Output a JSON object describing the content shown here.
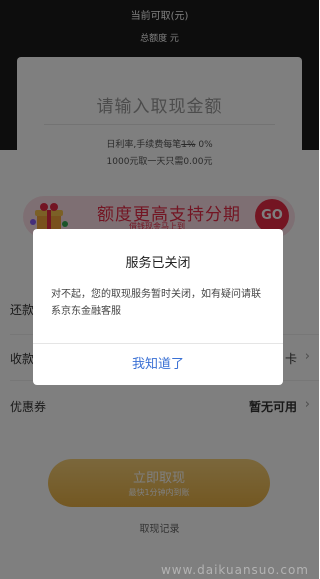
{
  "header": {
    "available_label": "当前可取(元)",
    "total_label": "总额度 元"
  },
  "amount_card": {
    "amount_placeholder": "请输入取现金额",
    "rate_prefix": "日利率,手续费每笔",
    "rate_old": "1%",
    "rate_new": " 0%",
    "interest_note": "1000元取一天只需0.00元"
  },
  "promo": {
    "title": "额度更高支持分期",
    "subtitle": "借钱现金马上到",
    "go_label": "GO"
  },
  "rows": {
    "repay_label": "还款",
    "receive_label": "收款",
    "receive_value": "卡",
    "coupon_label": "优惠券",
    "coupon_value": "暂无可用"
  },
  "withdraw_button": {
    "label": "立即取现",
    "sub": "最快1分钟内到账"
  },
  "records_link": "取现记录",
  "watermark": "www.daikuansuo.com",
  "dialog": {
    "title": "服务已关闭",
    "message": "对不起，您的取现服务暂时关闭，如有疑问请联系京东金融客服",
    "confirm_label": "我知道了"
  },
  "colors": {
    "accent_red": "#e62b46",
    "button_gold": "#e7b044",
    "link_blue": "#3a70d4"
  }
}
